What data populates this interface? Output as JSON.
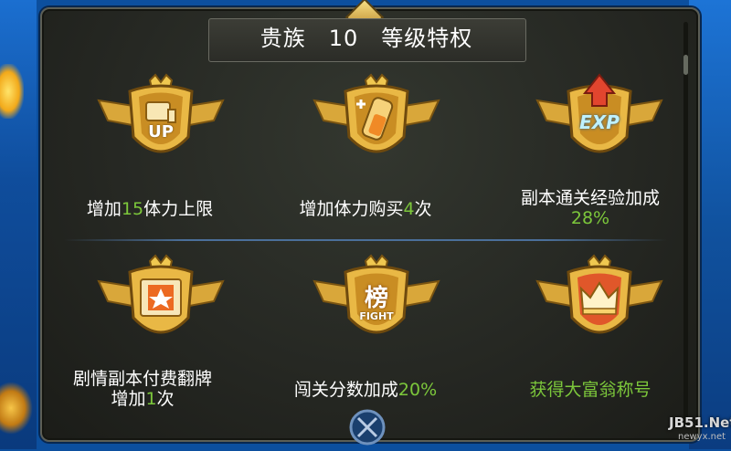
{
  "title": "贵族　10　等级特权",
  "perks": [
    {
      "icon": "stamina-up-icon",
      "icon_label": "UP",
      "pre": "增加",
      "value": "15",
      "post": "体力上限",
      "line2": ""
    },
    {
      "icon": "stamina-potion-icon",
      "icon_label": "",
      "pre": "增加体力购买",
      "value": "4",
      "post": "次",
      "line2": ""
    },
    {
      "icon": "exp-boost-icon",
      "icon_label": "EXP",
      "pre": "副本通关经验加成",
      "value": "",
      "post": "",
      "line2": "28%"
    },
    {
      "icon": "card-flip-icon",
      "icon_label": "",
      "pre": "剧情副本付费翻牌",
      "value": "",
      "post": "",
      "line2_pre": "增加",
      "line2_value": "1",
      "line2_post": "次"
    },
    {
      "icon": "fight-rank-icon",
      "icon_label": "FIGHT",
      "icon_glyph": "榜",
      "pre": "闯关分数加成",
      "value": "20%",
      "post": "",
      "line2": ""
    },
    {
      "icon": "crown-title-icon",
      "icon_label": "",
      "pre": "",
      "value": "获得大富翁称号",
      "post": "",
      "line2": ""
    }
  ],
  "watermark": {
    "line1": "JB51.Net",
    "line2": "newyx.net"
  },
  "colors": {
    "highlight": "#7cc73b",
    "gold": "#f1c650",
    "panel": "#262823"
  }
}
